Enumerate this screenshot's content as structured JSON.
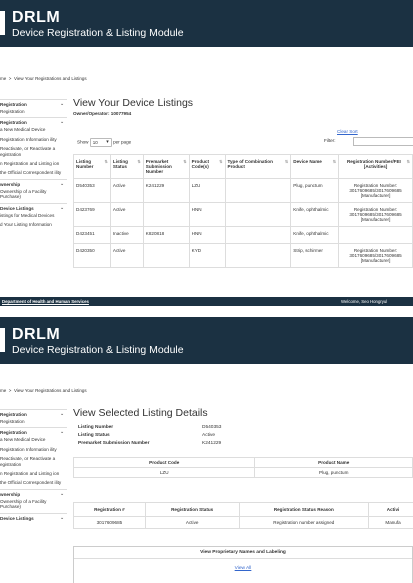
{
  "app": {
    "title": "DRLM",
    "subtitle": "Device Registration & Listing Module"
  },
  "breadcrumb": {
    "home": "me",
    "sep": ">",
    "current": "View Your Registrations and Listings"
  },
  "sidebar": {
    "sections": [
      {
        "label": "Registration",
        "items": [
          "Registration"
        ]
      },
      {
        "label": "Registration",
        "items": [
          "a New Medical Device",
          "Registration Information ility",
          "Reactivate, or Reactivate a egistration",
          "n Registration and Listing ion",
          "the Official Correspondent ility"
        ]
      },
      {
        "label": "wnership",
        "items": [
          "Ownership of a Facility Purchase)"
        ]
      },
      {
        "label": "Device Listings",
        "items": [
          "istings for Medical Devices",
          "d Your Listing Information"
        ]
      }
    ],
    "sections_bottom": [
      {
        "label": "Registration",
        "items": [
          "Registration"
        ]
      },
      {
        "label": "Registration",
        "items": [
          "a New Medical Device",
          "Registration Information ility",
          "Reactivate, or Reactivate a egistration",
          "n Registration and Listing ion",
          "the Official Correspondent ility"
        ]
      },
      {
        "label": "wnership",
        "items": [
          "Ownership of a Facility Purchase)"
        ]
      },
      {
        "label": "Device Listings",
        "items": []
      }
    ]
  },
  "listings": {
    "title": "View Your Device Listings",
    "owner": "Owner/Operator: 10077954",
    "show_label": "Show",
    "show_value": "10",
    "per_page_label": "per page",
    "clear_sort": "Clear Sort",
    "filter_label": "Filter:",
    "columns": [
      "Listing Number",
      "Listing Status",
      "Premarket Submission Number",
      "Product Code(s)",
      "Type of Combination Product",
      "Device Name",
      "Registration Number/FEI [Activities]"
    ],
    "rows": [
      [
        "D540353",
        "Active",
        "K241229",
        "LZU",
        "",
        "Plug, punctum",
        "Registration Number: 3017609685/3017609685 [Manufacturer]"
      ],
      [
        "D423769",
        "Active",
        "",
        "HNN",
        "",
        "Knife, ophthalmic",
        "Registration Number: 3017609685/3017609685 [Manufacturer]"
      ],
      [
        "D423451",
        "Inactive",
        "K820818",
        "HNN",
        "",
        "Knife, ophthalmic",
        ""
      ],
      [
        "D420350",
        "Active",
        "",
        "KYD",
        "",
        "Strip, schirmer",
        "Registration Number: 3017609685/3017609685 [Manufacturer]"
      ]
    ]
  },
  "footer": {
    "left": "Department of Health and Human Services",
    "right": "Welcome, Seo Hongryul"
  },
  "details": {
    "title": "View Selected Listing Details",
    "fields": [
      {
        "label": "Listing Number",
        "value": "D540353"
      },
      {
        "label": "Listing Status",
        "value": "Active"
      },
      {
        "label": "Premarket Submission Number",
        "value": "K241229"
      }
    ],
    "product_headers": [
      "Product Code",
      "Product Name"
    ],
    "product_row": [
      "LZU",
      "Plug, punctum"
    ],
    "reg_headers": [
      "Registration #",
      "Registration Status",
      "Registration Status Reason",
      "Activi"
    ],
    "reg_row": [
      "3017609685",
      "Active",
      "Registration number assigned",
      "Manufa"
    ],
    "proprietary_title": "View Proprietary Names and Labeling",
    "view_all": "View All"
  }
}
